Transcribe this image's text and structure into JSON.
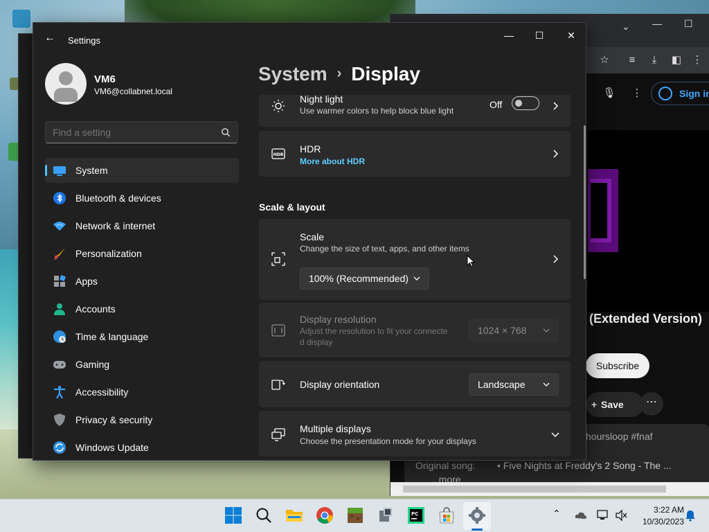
{
  "window": {
    "app_title": "Settings",
    "minimize": "—",
    "maximize": "☐",
    "close": "✕"
  },
  "profile": {
    "name": "VM6",
    "email": "VM6@collabnet.local"
  },
  "search": {
    "placeholder": "Find a setting"
  },
  "nav": {
    "items": [
      {
        "label": "System",
        "icon": "system-icon",
        "active": true
      },
      {
        "label": "Bluetooth & devices",
        "icon": "bluetooth-icon"
      },
      {
        "label": "Network & internet",
        "icon": "wifi-icon"
      },
      {
        "label": "Personalization",
        "icon": "brush-icon"
      },
      {
        "label": "Apps",
        "icon": "apps-icon"
      },
      {
        "label": "Accounts",
        "icon": "accounts-icon"
      },
      {
        "label": "Time & language",
        "icon": "globe-clock-icon"
      },
      {
        "label": "Gaming",
        "icon": "gamepad-icon"
      },
      {
        "label": "Accessibility",
        "icon": "accessibility-icon"
      },
      {
        "label": "Privacy & security",
        "icon": "shield-icon"
      },
      {
        "label": "Windows Update",
        "icon": "update-icon"
      }
    ]
  },
  "breadcrumb": {
    "parent": "System",
    "separator": "›",
    "current": "Display"
  },
  "content": {
    "night_light": {
      "title": "Night light",
      "subtitle": "Use warmer colors to help block blue light",
      "state": "Off"
    },
    "hdr": {
      "title": "HDR",
      "link": "More about HDR"
    },
    "section_scale_layout": "Scale & layout",
    "scale": {
      "title": "Scale",
      "subtitle": "Change the size of text, apps, and other items",
      "value": "100% (Recommended)"
    },
    "resolution": {
      "title": "Display resolution",
      "subtitle_line1": "Adjust the resolution to fit your connecte",
      "subtitle_line2": "d display",
      "value": "1024 × 768"
    },
    "orientation": {
      "title": "Display orientation",
      "value": "Landscape"
    },
    "multiple_displays": {
      "title": "Multiple displays",
      "subtitle": "Choose the presentation mode for your displays"
    }
  },
  "browser": {
    "signin": "Sign in",
    "video_title": "(Extended Version)",
    "subscribe": "Subscribe",
    "save": "Save",
    "desc_tags": "hoursloop #fnaf",
    "desc_original_label": "Original song:",
    "desc_original_song": "• Five Nights at Freddy's 2 Song - The ...",
    "desc_more": "...more"
  },
  "taskbar": {
    "time": "3:22 AM",
    "date": "10/30/2023",
    "apps": [
      "start-icon",
      "search-icon",
      "file-explorer-icon",
      "chrome-icon",
      "minecraft-icon",
      "app-icon",
      "pycharm-icon",
      "store-icon",
      "settings-icon"
    ]
  },
  "colors": {
    "accent": "#4cc2ff",
    "link": "#60cdff",
    "window_bg": "#202020",
    "card_bg": "#2b2b2b"
  }
}
